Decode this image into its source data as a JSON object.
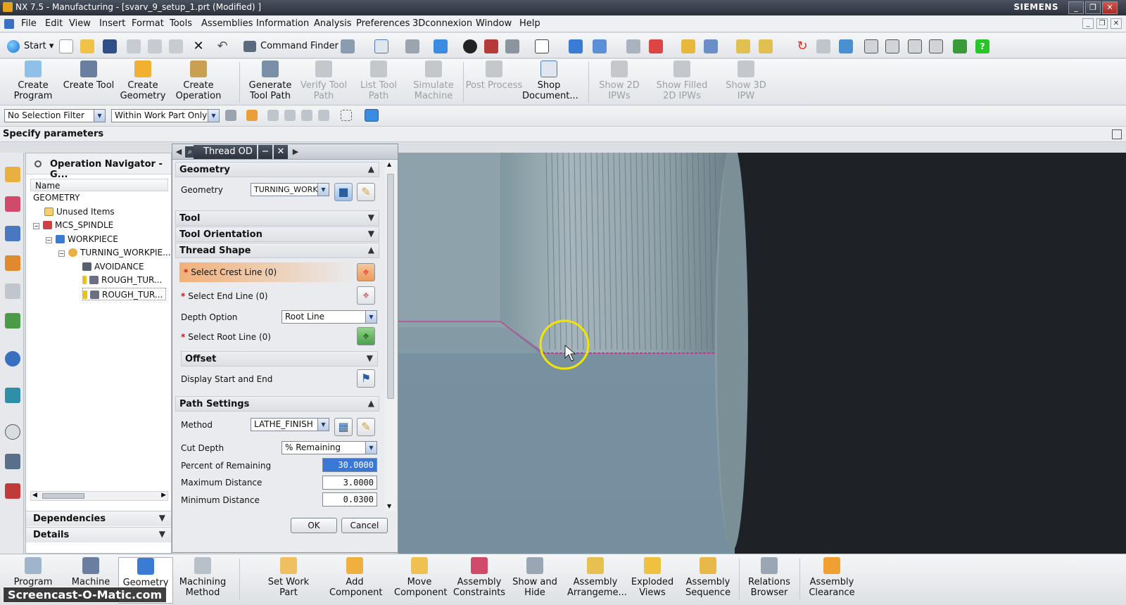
{
  "window": {
    "title": "NX 7.5 - Manufacturing - [svarv_9_setup_1.prt (Modified) ]",
    "brand": "SIEMENS",
    "controls": [
      "_",
      "❐",
      "✕"
    ]
  },
  "menubar": {
    "items": [
      "File",
      "Edit",
      "View",
      "Insert",
      "Format",
      "Tools",
      "Assemblies",
      "Information",
      "Analysis",
      "Preferences",
      "3Dconnexion",
      "Window",
      "Help"
    ]
  },
  "standard_toolbar": {
    "start_label": "Start",
    "command_finder_label": "Command Finder"
  },
  "manufacturing_toolbar": {
    "buttons": [
      {
        "label": "Create Program",
        "enabled": true
      },
      {
        "label": "Create Tool",
        "enabled": true
      },
      {
        "label": "Create Geometry",
        "enabled": true
      },
      {
        "label": "Create Operation",
        "enabled": true
      },
      {
        "label": "Generate Tool Path",
        "enabled": true
      },
      {
        "label": "Verify Tool Path",
        "enabled": false
      },
      {
        "label": "List Tool Path",
        "enabled": false
      },
      {
        "label": "Simulate Machine",
        "enabled": false
      },
      {
        "label": "Post Process",
        "enabled": false
      },
      {
        "label": "Shop Document...",
        "enabled": true
      },
      {
        "label": "Show 2D IPWs",
        "enabled": false
      },
      {
        "label": "Show Filled 2D IPWs",
        "enabled": false
      },
      {
        "label": "Show 3D IPW",
        "enabled": false
      }
    ]
  },
  "selection_bar": {
    "filter": "No Selection Filter",
    "scope": "Within Work Part Only"
  },
  "cue_line": "Specify parameters",
  "navigator": {
    "title": "Operation Navigator - G...",
    "column": "Name",
    "rows": [
      "GEOMETRY",
      "Unused Items",
      "MCS_SPINDLE",
      "WORKPIECE",
      "TURNING_WORKPIE...",
      "AVOIDANCE",
      "ROUGH_TUR...",
      "ROUGH_TUR..."
    ],
    "sections": [
      "Dependencies",
      "Details"
    ]
  },
  "dialog": {
    "title": "Thread OD",
    "geometry_section": "Geometry",
    "geometry_label": "Geometry",
    "geometry_value": "TURNING_WORK",
    "tool_section": "Tool",
    "tool_orientation_section": "Tool Orientation",
    "thread_shape_section": "Thread Shape",
    "select_crest_line": "Select Crest Line (0)",
    "select_end_line": "Select End Line (0)",
    "depth_option_label": "Depth Option",
    "depth_option_value": "Root Line",
    "select_root_line": "Select Root Line (0)",
    "offset_section": "Offset",
    "display_start_end": "Display Start and End",
    "path_settings_section": "Path Settings",
    "method_label": "Method",
    "method_value": "LATHE_FINISH",
    "cut_depth_label": "Cut Depth",
    "cut_depth_value": "% Remaining",
    "percent_remaining_label": "Percent of Remaining",
    "percent_remaining_value": "30.0000",
    "max_distance_label": "Maximum Distance",
    "max_distance_value": "3.0000",
    "min_distance_label": "Minimum Distance",
    "min_distance_value": "0.0300",
    "ok_label": "OK",
    "cancel_label": "Cancel"
  },
  "bottom_toolbar": {
    "buttons": [
      "Program",
      "Machine",
      "Geometry",
      "Machining Method",
      "Set Work Part",
      "Add Component",
      "Move Component",
      "Assembly Constraints",
      "Show and Hide",
      "Assembly Arrangeme...",
      "Exploded Views",
      "Assembly Sequence",
      "Relations Browser",
      "Assembly Clearance"
    ]
  },
  "watermark": "Screencast-O-Matic.com",
  "colors": {
    "highlight_row": "#f2b078",
    "crest_color": "#c4398f",
    "cursor_ring": "#f2e600"
  }
}
